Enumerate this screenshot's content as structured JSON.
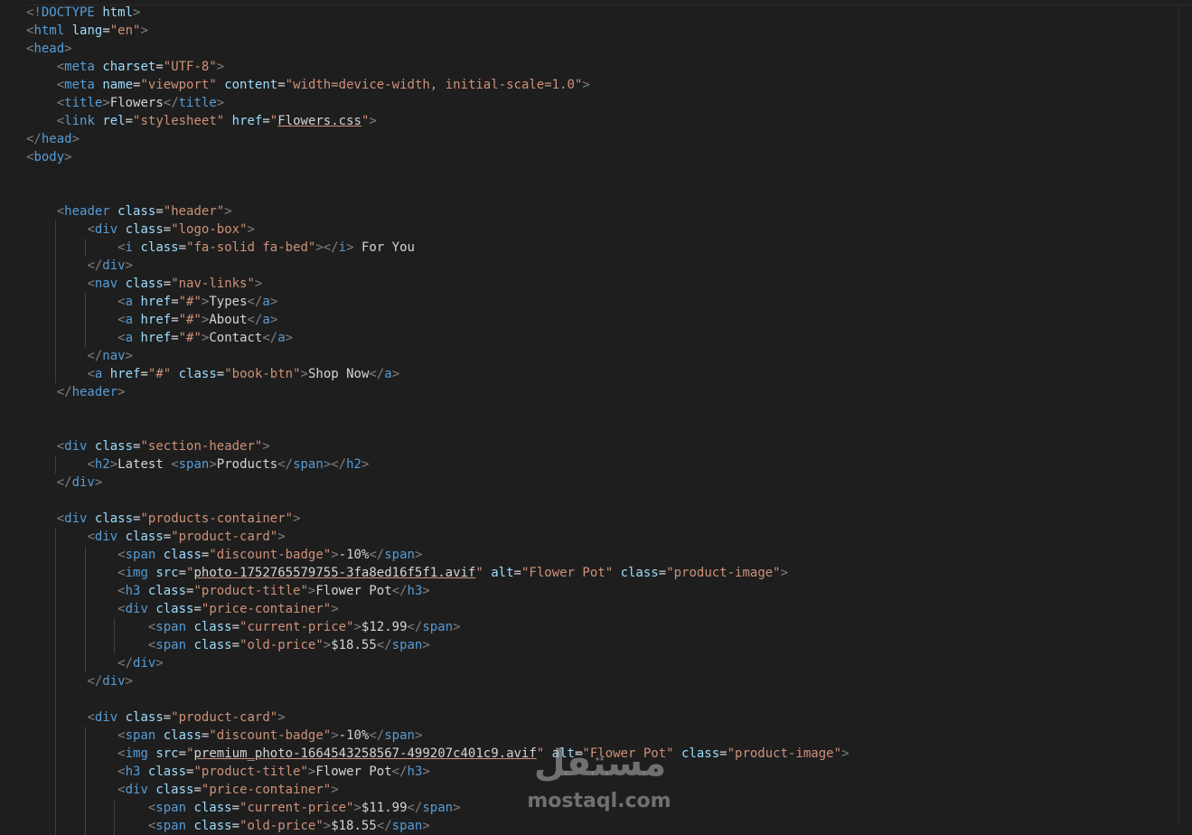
{
  "code_lines": [
    [
      [
        "br",
        "<!"
      ],
      [
        "tag",
        "DOCTYPE"
      ],
      [
        "tx",
        " "
      ],
      [
        "at",
        "html"
      ],
      [
        "br",
        ">"
      ]
    ],
    [
      [
        "br",
        "<"
      ],
      [
        "tag",
        "html"
      ],
      [
        "tx",
        " "
      ],
      [
        "at",
        "lang"
      ],
      [
        "tx",
        "="
      ],
      [
        "sv",
        "\"en\""
      ],
      [
        "br",
        ">"
      ]
    ],
    [
      [
        "br",
        "<"
      ],
      [
        "tag",
        "head"
      ],
      [
        "br",
        ">"
      ]
    ],
    [
      [
        "tx",
        "    "
      ],
      [
        "br",
        "<"
      ],
      [
        "tag",
        "meta"
      ],
      [
        "tx",
        " "
      ],
      [
        "at",
        "charset"
      ],
      [
        "tx",
        "="
      ],
      [
        "sv",
        "\"UTF-8\""
      ],
      [
        "br",
        ">"
      ]
    ],
    [
      [
        "tx",
        "    "
      ],
      [
        "br",
        "<"
      ],
      [
        "tag",
        "meta"
      ],
      [
        "tx",
        " "
      ],
      [
        "at",
        "name"
      ],
      [
        "tx",
        "="
      ],
      [
        "sv",
        "\"viewport\""
      ],
      [
        "tx",
        " "
      ],
      [
        "at",
        "content"
      ],
      [
        "tx",
        "="
      ],
      [
        "sv",
        "\"width=device-width, initial-scale=1.0\""
      ],
      [
        "br",
        ">"
      ]
    ],
    [
      [
        "tx",
        "    "
      ],
      [
        "br",
        "<"
      ],
      [
        "tag",
        "title"
      ],
      [
        "br",
        ">"
      ],
      [
        "tx",
        "Flowers"
      ],
      [
        "br",
        "</"
      ],
      [
        "tag",
        "title"
      ],
      [
        "br",
        ">"
      ]
    ],
    [
      [
        "tx",
        "    "
      ],
      [
        "br",
        "<"
      ],
      [
        "tag",
        "link"
      ],
      [
        "tx",
        " "
      ],
      [
        "at",
        "rel"
      ],
      [
        "tx",
        "="
      ],
      [
        "sv",
        "\"stylesheet\""
      ],
      [
        "tx",
        " "
      ],
      [
        "at",
        "href"
      ],
      [
        "tx",
        "="
      ],
      [
        "sv",
        "\""
      ],
      [
        "link",
        "Flowers.css"
      ],
      [
        "sv",
        "\""
      ],
      [
        "br",
        ">"
      ]
    ],
    [
      [
        "br",
        "</"
      ],
      [
        "tag",
        "head"
      ],
      [
        "br",
        ">"
      ]
    ],
    [
      [
        "br",
        "<"
      ],
      [
        "tag",
        "body"
      ],
      [
        "br",
        ">"
      ]
    ],
    [],
    [],
    [
      [
        "tx",
        "    "
      ],
      [
        "br",
        "<"
      ],
      [
        "tag",
        "header"
      ],
      [
        "tx",
        " "
      ],
      [
        "at",
        "class"
      ],
      [
        "tx",
        "="
      ],
      [
        "sv",
        "\"header\""
      ],
      [
        "br",
        ">"
      ]
    ],
    [
      [
        "tx",
        "        "
      ],
      [
        "br",
        "<"
      ],
      [
        "tag",
        "div"
      ],
      [
        "tx",
        " "
      ],
      [
        "at",
        "class"
      ],
      [
        "tx",
        "="
      ],
      [
        "sv",
        "\"logo-box\""
      ],
      [
        "br",
        ">"
      ]
    ],
    [
      [
        "tx",
        "            "
      ],
      [
        "br",
        "<"
      ],
      [
        "tag",
        "i"
      ],
      [
        "tx",
        " "
      ],
      [
        "at",
        "class"
      ],
      [
        "tx",
        "="
      ],
      [
        "sv",
        "\"fa-solid fa-bed\""
      ],
      [
        "br",
        "></"
      ],
      [
        "tag",
        "i"
      ],
      [
        "br",
        ">"
      ],
      [
        "tx",
        " For You"
      ]
    ],
    [
      [
        "tx",
        "        "
      ],
      [
        "br",
        "</"
      ],
      [
        "tag",
        "div"
      ],
      [
        "br",
        ">"
      ]
    ],
    [
      [
        "tx",
        "        "
      ],
      [
        "br",
        "<"
      ],
      [
        "tag",
        "nav"
      ],
      [
        "tx",
        " "
      ],
      [
        "at",
        "class"
      ],
      [
        "tx",
        "="
      ],
      [
        "sv",
        "\"nav-links\""
      ],
      [
        "br",
        ">"
      ]
    ],
    [
      [
        "tx",
        "            "
      ],
      [
        "br",
        "<"
      ],
      [
        "tag",
        "a"
      ],
      [
        "tx",
        " "
      ],
      [
        "at",
        "href"
      ],
      [
        "tx",
        "="
      ],
      [
        "sv",
        "\"#\""
      ],
      [
        "br",
        ">"
      ],
      [
        "tx",
        "Types"
      ],
      [
        "br",
        "</"
      ],
      [
        "tag",
        "a"
      ],
      [
        "br",
        ">"
      ]
    ],
    [
      [
        "tx",
        "            "
      ],
      [
        "br",
        "<"
      ],
      [
        "tag",
        "a"
      ],
      [
        "tx",
        " "
      ],
      [
        "at",
        "href"
      ],
      [
        "tx",
        "="
      ],
      [
        "sv",
        "\"#\""
      ],
      [
        "br",
        ">"
      ],
      [
        "tx",
        "About"
      ],
      [
        "br",
        "</"
      ],
      [
        "tag",
        "a"
      ],
      [
        "br",
        ">"
      ]
    ],
    [
      [
        "tx",
        "            "
      ],
      [
        "br",
        "<"
      ],
      [
        "tag",
        "a"
      ],
      [
        "tx",
        " "
      ],
      [
        "at",
        "href"
      ],
      [
        "tx",
        "="
      ],
      [
        "sv",
        "\"#\""
      ],
      [
        "br",
        ">"
      ],
      [
        "tx",
        "Contact"
      ],
      [
        "br",
        "</"
      ],
      [
        "tag",
        "a"
      ],
      [
        "br",
        ">"
      ]
    ],
    [
      [
        "tx",
        "        "
      ],
      [
        "br",
        "</"
      ],
      [
        "tag",
        "nav"
      ],
      [
        "br",
        ">"
      ]
    ],
    [
      [
        "tx",
        "        "
      ],
      [
        "br",
        "<"
      ],
      [
        "tag",
        "a"
      ],
      [
        "tx",
        " "
      ],
      [
        "at",
        "href"
      ],
      [
        "tx",
        "="
      ],
      [
        "sv",
        "\"#\""
      ],
      [
        "tx",
        " "
      ],
      [
        "at",
        "class"
      ],
      [
        "tx",
        "="
      ],
      [
        "sv",
        "\"book-btn\""
      ],
      [
        "br",
        ">"
      ],
      [
        "tx",
        "Shop Now"
      ],
      [
        "br",
        "</"
      ],
      [
        "tag",
        "a"
      ],
      [
        "br",
        ">"
      ]
    ],
    [
      [
        "tx",
        "    "
      ],
      [
        "br",
        "</"
      ],
      [
        "tag",
        "header"
      ],
      [
        "br",
        ">"
      ]
    ],
    [],
    [],
    [
      [
        "tx",
        "    "
      ],
      [
        "br",
        "<"
      ],
      [
        "tag",
        "div"
      ],
      [
        "tx",
        " "
      ],
      [
        "at",
        "class"
      ],
      [
        "tx",
        "="
      ],
      [
        "sv",
        "\"section-header\""
      ],
      [
        "br",
        ">"
      ]
    ],
    [
      [
        "tx",
        "        "
      ],
      [
        "br",
        "<"
      ],
      [
        "tag",
        "h2"
      ],
      [
        "br",
        ">"
      ],
      [
        "tx",
        "Latest "
      ],
      [
        "br",
        "<"
      ],
      [
        "tag",
        "span"
      ],
      [
        "br",
        ">"
      ],
      [
        "tx",
        "Products"
      ],
      [
        "br",
        "</"
      ],
      [
        "tag",
        "span"
      ],
      [
        "br",
        "></"
      ],
      [
        "tag",
        "h2"
      ],
      [
        "br",
        ">"
      ]
    ],
    [
      [
        "tx",
        "    "
      ],
      [
        "br",
        "</"
      ],
      [
        "tag",
        "div"
      ],
      [
        "br",
        ">"
      ]
    ],
    [],
    [
      [
        "tx",
        "    "
      ],
      [
        "br",
        "<"
      ],
      [
        "tag",
        "div"
      ],
      [
        "tx",
        " "
      ],
      [
        "at",
        "class"
      ],
      [
        "tx",
        "="
      ],
      [
        "sv",
        "\"products-container\""
      ],
      [
        "br",
        ">"
      ]
    ],
    [
      [
        "tx",
        "        "
      ],
      [
        "br",
        "<"
      ],
      [
        "tag",
        "div"
      ],
      [
        "tx",
        " "
      ],
      [
        "at",
        "class"
      ],
      [
        "tx",
        "="
      ],
      [
        "sv",
        "\"product-card\""
      ],
      [
        "br",
        ">"
      ]
    ],
    [
      [
        "tx",
        "            "
      ],
      [
        "br",
        "<"
      ],
      [
        "tag",
        "span"
      ],
      [
        "tx",
        " "
      ],
      [
        "at",
        "class"
      ],
      [
        "tx",
        "="
      ],
      [
        "sv",
        "\"discount-badge\""
      ],
      [
        "br",
        ">"
      ],
      [
        "tx",
        "-10%"
      ],
      [
        "br",
        "</"
      ],
      [
        "tag",
        "span"
      ],
      [
        "br",
        ">"
      ]
    ],
    [
      [
        "tx",
        "            "
      ],
      [
        "br",
        "<"
      ],
      [
        "tag",
        "img"
      ],
      [
        "tx",
        " "
      ],
      [
        "at",
        "src"
      ],
      [
        "tx",
        "="
      ],
      [
        "sv",
        "\""
      ],
      [
        "link",
        "photo-1752765579755-3fa8ed16f5f1.avif"
      ],
      [
        "sv",
        "\""
      ],
      [
        "tx",
        " "
      ],
      [
        "at",
        "alt"
      ],
      [
        "tx",
        "="
      ],
      [
        "sv",
        "\"Flower Pot\""
      ],
      [
        "tx",
        " "
      ],
      [
        "at",
        "class"
      ],
      [
        "tx",
        "="
      ],
      [
        "sv",
        "\"product-image\""
      ],
      [
        "br",
        ">"
      ]
    ],
    [
      [
        "tx",
        "            "
      ],
      [
        "br",
        "<"
      ],
      [
        "tag",
        "h3"
      ],
      [
        "tx",
        " "
      ],
      [
        "at",
        "class"
      ],
      [
        "tx",
        "="
      ],
      [
        "sv",
        "\"product-title\""
      ],
      [
        "br",
        ">"
      ],
      [
        "tx",
        "Flower Pot"
      ],
      [
        "br",
        "</"
      ],
      [
        "tag",
        "h3"
      ],
      [
        "br",
        ">"
      ]
    ],
    [
      [
        "tx",
        "            "
      ],
      [
        "br",
        "<"
      ],
      [
        "tag",
        "div"
      ],
      [
        "tx",
        " "
      ],
      [
        "at",
        "class"
      ],
      [
        "tx",
        "="
      ],
      [
        "sv",
        "\"price-container\""
      ],
      [
        "br",
        ">"
      ]
    ],
    [
      [
        "tx",
        "                "
      ],
      [
        "br",
        "<"
      ],
      [
        "tag",
        "span"
      ],
      [
        "tx",
        " "
      ],
      [
        "at",
        "class"
      ],
      [
        "tx",
        "="
      ],
      [
        "sv",
        "\"current-price\""
      ],
      [
        "br",
        ">"
      ],
      [
        "tx",
        "$12.99"
      ],
      [
        "br",
        "</"
      ],
      [
        "tag",
        "span"
      ],
      [
        "br",
        ">"
      ]
    ],
    [
      [
        "tx",
        "                "
      ],
      [
        "br",
        "<"
      ],
      [
        "tag",
        "span"
      ],
      [
        "tx",
        " "
      ],
      [
        "at",
        "class"
      ],
      [
        "tx",
        "="
      ],
      [
        "sv",
        "\"old-price\""
      ],
      [
        "br",
        ">"
      ],
      [
        "tx",
        "$18.55"
      ],
      [
        "br",
        "</"
      ],
      [
        "tag",
        "span"
      ],
      [
        "br",
        ">"
      ]
    ],
    [
      [
        "tx",
        "            "
      ],
      [
        "br",
        "</"
      ],
      [
        "tag",
        "div"
      ],
      [
        "br",
        ">"
      ]
    ],
    [
      [
        "tx",
        "        "
      ],
      [
        "br",
        "</"
      ],
      [
        "tag",
        "div"
      ],
      [
        "br",
        ">"
      ]
    ],
    [],
    [
      [
        "tx",
        "        "
      ],
      [
        "br",
        "<"
      ],
      [
        "tag",
        "div"
      ],
      [
        "tx",
        " "
      ],
      [
        "at",
        "class"
      ],
      [
        "tx",
        "="
      ],
      [
        "sv",
        "\"product-card\""
      ],
      [
        "br",
        ">"
      ]
    ],
    [
      [
        "tx",
        "            "
      ],
      [
        "br",
        "<"
      ],
      [
        "tag",
        "span"
      ],
      [
        "tx",
        " "
      ],
      [
        "at",
        "class"
      ],
      [
        "tx",
        "="
      ],
      [
        "sv",
        "\"discount-badge\""
      ],
      [
        "br",
        ">"
      ],
      [
        "tx",
        "-10%"
      ],
      [
        "br",
        "</"
      ],
      [
        "tag",
        "span"
      ],
      [
        "br",
        ">"
      ]
    ],
    [
      [
        "tx",
        "            "
      ],
      [
        "br",
        "<"
      ],
      [
        "tag",
        "img"
      ],
      [
        "tx",
        " "
      ],
      [
        "at",
        "src"
      ],
      [
        "tx",
        "="
      ],
      [
        "sv",
        "\""
      ],
      [
        "link",
        "premium_photo-1664543258567-499207c401c9.avif"
      ],
      [
        "sv",
        "\""
      ],
      [
        "tx",
        " "
      ],
      [
        "at",
        "alt"
      ],
      [
        "tx",
        "="
      ],
      [
        "sv",
        "\"Flower Pot\""
      ],
      [
        "tx",
        " "
      ],
      [
        "at",
        "class"
      ],
      [
        "tx",
        "="
      ],
      [
        "sv",
        "\"product-image\""
      ],
      [
        "br",
        ">"
      ]
    ],
    [
      [
        "tx",
        "            "
      ],
      [
        "br",
        "<"
      ],
      [
        "tag",
        "h3"
      ],
      [
        "tx",
        " "
      ],
      [
        "at",
        "class"
      ],
      [
        "tx",
        "="
      ],
      [
        "sv",
        "\"product-title\""
      ],
      [
        "br",
        ">"
      ],
      [
        "tx",
        "Flower Pot"
      ],
      [
        "br",
        "</"
      ],
      [
        "tag",
        "h3"
      ],
      [
        "br",
        ">"
      ]
    ],
    [
      [
        "tx",
        "            "
      ],
      [
        "br",
        "<"
      ],
      [
        "tag",
        "div"
      ],
      [
        "tx",
        " "
      ],
      [
        "at",
        "class"
      ],
      [
        "tx",
        "="
      ],
      [
        "sv",
        "\"price-container\""
      ],
      [
        "br",
        ">"
      ]
    ],
    [
      [
        "tx",
        "                "
      ],
      [
        "br",
        "<"
      ],
      [
        "tag",
        "span"
      ],
      [
        "tx",
        " "
      ],
      [
        "at",
        "class"
      ],
      [
        "tx",
        "="
      ],
      [
        "sv",
        "\"current-price\""
      ],
      [
        "br",
        ">"
      ],
      [
        "tx",
        "$11.99"
      ],
      [
        "br",
        "</"
      ],
      [
        "tag",
        "span"
      ],
      [
        "br",
        ">"
      ]
    ],
    [
      [
        "tx",
        "                "
      ],
      [
        "br",
        "<"
      ],
      [
        "tag",
        "span"
      ],
      [
        "tx",
        " "
      ],
      [
        "at",
        "class"
      ],
      [
        "tx",
        "="
      ],
      [
        "sv",
        "\"old-price\""
      ],
      [
        "br",
        ">"
      ],
      [
        "tx",
        "$18.55"
      ],
      [
        "br",
        "</"
      ],
      [
        "tag",
        "span"
      ],
      [
        "br",
        ">"
      ]
    ]
  ],
  "watermark": {
    "arabic_logo": "مستقل",
    "site": "mostaql.com"
  },
  "colors": {
    "background": "#1e1e1e",
    "tag": "#569cd6",
    "bracket": "#808080",
    "attribute": "#9cdcfe",
    "string": "#ce9178",
    "text": "#d4d4d4"
  }
}
